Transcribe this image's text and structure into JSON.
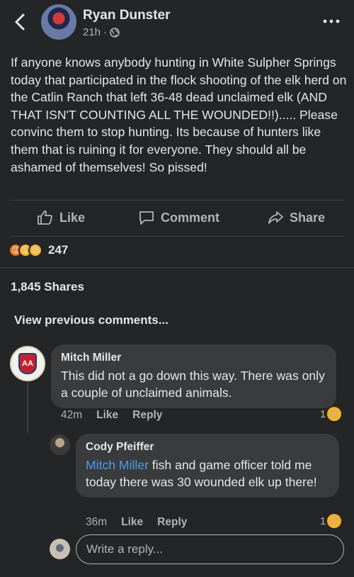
{
  "header": {
    "author": "Ryan Dunster",
    "time": "21h",
    "privacy_icon": "globe-icon"
  },
  "post": {
    "text": "If anyone knows anybody hunting in White Sulpher Springs today that participated in the flock shooting of the elk herd on the Catlin Ranch that left 36-48 dead unclaimed elk (AND THAT ISN'T COUNTING ALL THE WOUNDED!!)..... Please convinc them to stop hunting. Its because of hunters like them that is ruining it for everyone. They should all be ashamed of themselves! So pissed!"
  },
  "actions": {
    "like": "Like",
    "comment": "Comment",
    "share": "Share"
  },
  "reactions": {
    "icons": [
      "angry-reaction-icon",
      "wow-reaction-icon",
      "sad-reaction-icon"
    ],
    "count": "247"
  },
  "shares": "1,845 Shares",
  "view_previous": "View previous comments...",
  "comments": [
    {
      "author": "Mitch Miller",
      "text": "This did not a go down this way. There was only a couple of unclaimed animals.",
      "time": "42m",
      "like_label": "Like",
      "reply_label": "Reply",
      "reaction_count": "1",
      "reaction_icon": "wow-reaction-icon"
    },
    {
      "author": "Cody Pfeiffer",
      "mention": "Mitch Miller",
      "text": " fish and game officer told me today there was 30 wounded elk up there!",
      "time": "36m",
      "like_label": "Like",
      "reply_label": "Reply",
      "reaction_count": "1",
      "reaction_icon": "sad-reaction-icon"
    }
  ],
  "reply_input": {
    "placeholder": "Write a reply..."
  },
  "colors": {
    "background": "#242526",
    "bubble": "#3a3b3c",
    "text": "#e4e6eb",
    "secondary": "#b0b3b8",
    "mention": "#4b9cf5"
  }
}
